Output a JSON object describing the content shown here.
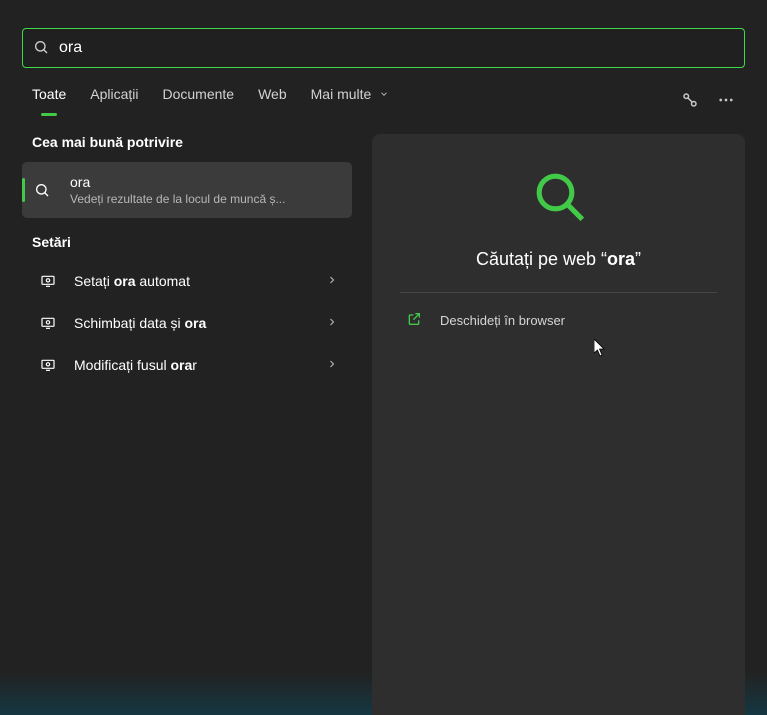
{
  "search": {
    "query": "ora",
    "placeholder": ""
  },
  "tabs": {
    "items": [
      {
        "label": "Toate",
        "active": true
      },
      {
        "label": "Aplicații",
        "active": false
      },
      {
        "label": "Documente",
        "active": false
      },
      {
        "label": "Web",
        "active": false
      },
      {
        "label": "Mai multe",
        "active": false,
        "has_chevron": true
      }
    ]
  },
  "left": {
    "best_match_label": "Cea mai bună potrivire",
    "best_match": {
      "title": "ora",
      "subtitle": "Vedeți rezultate de la locul de muncă ș..."
    },
    "settings_label": "Setări",
    "settings": [
      {
        "pre": "Setați ",
        "hl": "ora",
        "post": " automat"
      },
      {
        "pre": "Schimbați data și ",
        "hl": "ora",
        "post": ""
      },
      {
        "pre": "Modificați fusul ",
        "hl": "ora",
        "post": "r"
      }
    ]
  },
  "right": {
    "caption_pre": "Căutați pe web “",
    "caption_query": "ora",
    "caption_post": "”",
    "open_browser": "Deschideți în browser"
  },
  "colors": {
    "accent": "#42c948"
  }
}
